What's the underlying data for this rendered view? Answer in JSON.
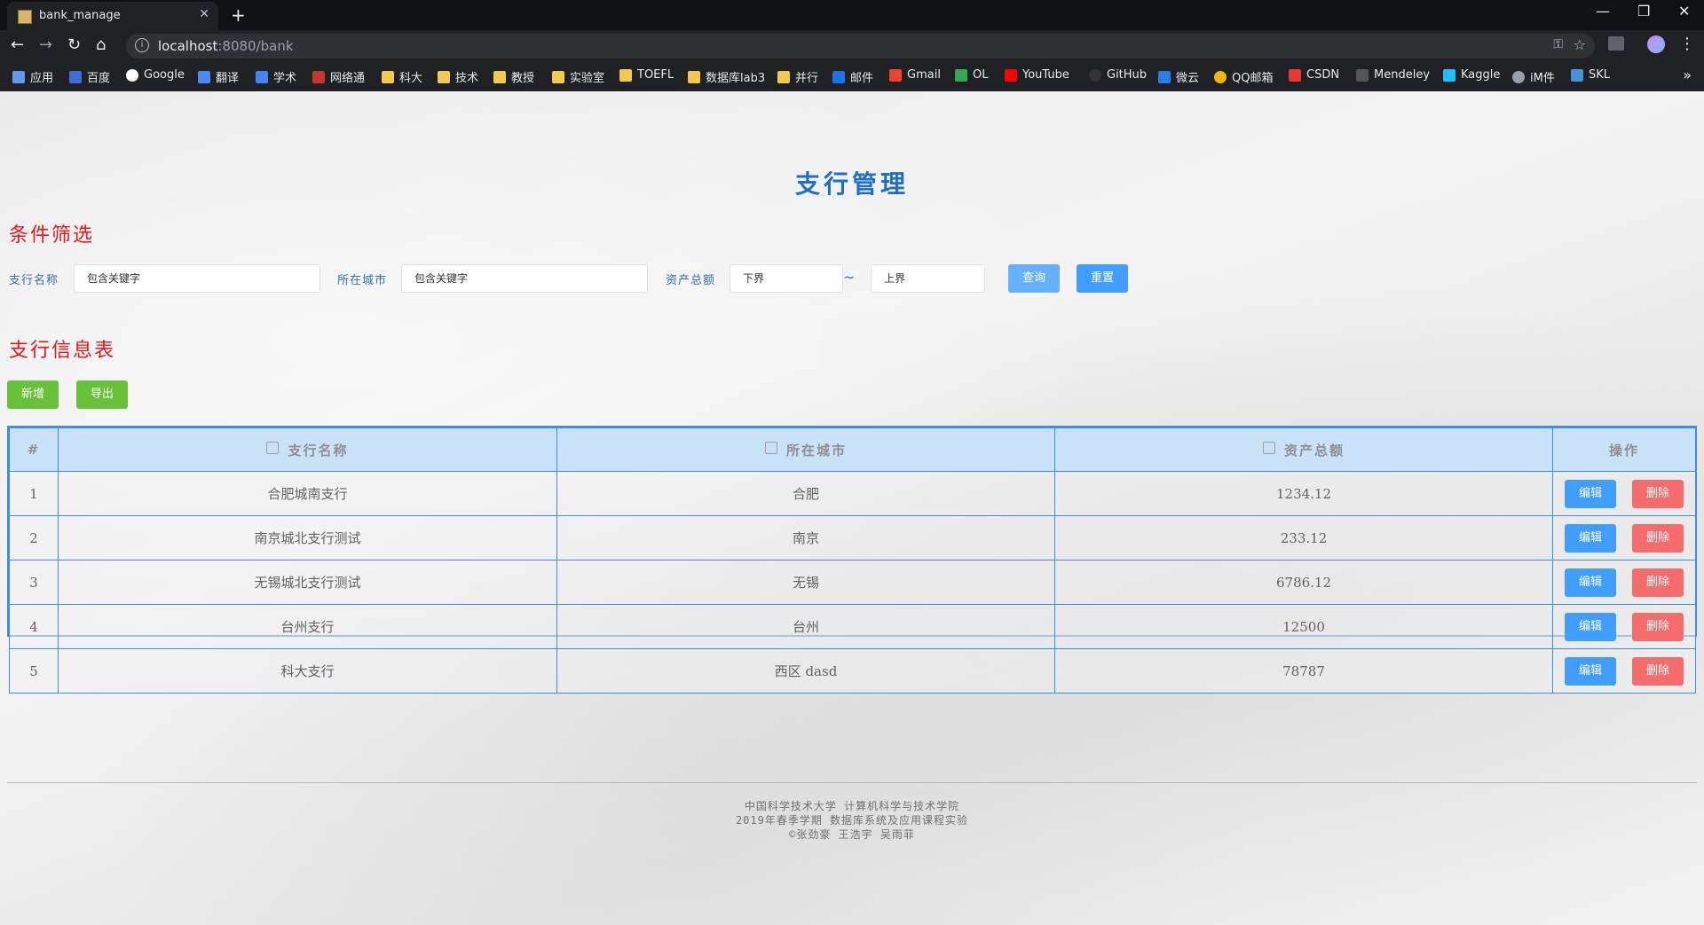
{
  "browser": {
    "tab_title": "bank_manage",
    "url_host": "localhost",
    "url_rest": ":8080/bank",
    "bookmarks": [
      "应用",
      "百度",
      "Google",
      "翻译",
      "学术",
      "网络通",
      "科大",
      "技术",
      "教授",
      "实验室",
      "TOEFL",
      "数据库lab3",
      "并行",
      "邮件",
      "Gmail",
      "OL",
      "YouTube",
      "GitHub",
      "微云",
      "QQ邮箱",
      "CSDN",
      "Mendeley",
      "Kaggle",
      "iM件",
      "SKL"
    ]
  },
  "page": {
    "title": "支行管理",
    "filter_section": "条件筛选",
    "table_section": "支行信息表"
  },
  "filters": {
    "branch_label": "支行名称",
    "branch_placeholder": "包含关键字",
    "city_label": "所在城市",
    "city_placeholder": "包含关键字",
    "assets_label": "资产总额",
    "assets_lower_placeholder": "下界",
    "tilde": "~",
    "assets_upper_placeholder": "上界",
    "query_btn": "查询",
    "reset_btn": "重置"
  },
  "actions": {
    "add_btn": "新增",
    "export_btn": "导出"
  },
  "table": {
    "headers": {
      "index": "#",
      "branch": "支行名称",
      "city": "所在城市",
      "assets": "资产总额",
      "ops": "操作"
    },
    "edit_btn": "编辑",
    "delete_btn": "删除",
    "rows": [
      {
        "idx": "1",
        "branch": "合肥城南支行",
        "city": "合肥",
        "assets": "1234.12"
      },
      {
        "idx": "2",
        "branch": "南京城北支行测试",
        "city": "南京",
        "assets": "233.12"
      },
      {
        "idx": "3",
        "branch": "无锡城北支行测试",
        "city": "无锡",
        "assets": "6786.12"
      },
      {
        "idx": "4",
        "branch": "台州支行",
        "city": "台州",
        "assets": "12500"
      },
      {
        "idx": "5",
        "branch": "科大支行",
        "city": "西区 dasd",
        "assets": "78787"
      }
    ]
  },
  "footer": {
    "line1": "中国科学技术大学 计算机科学与技术学院",
    "line2": "2019年春季学期 数据库系统及应用课程实验",
    "line3": "©张劲豪 王浩宇 吴雨菲"
  },
  "colors": {
    "title": "#1f6fc5",
    "section": "#e8161a",
    "primary": "#409eff",
    "success": "#67c23a",
    "danger": "#f56c6c",
    "table_border": "#3a8ee6",
    "table_header": "#c9e2f8"
  }
}
